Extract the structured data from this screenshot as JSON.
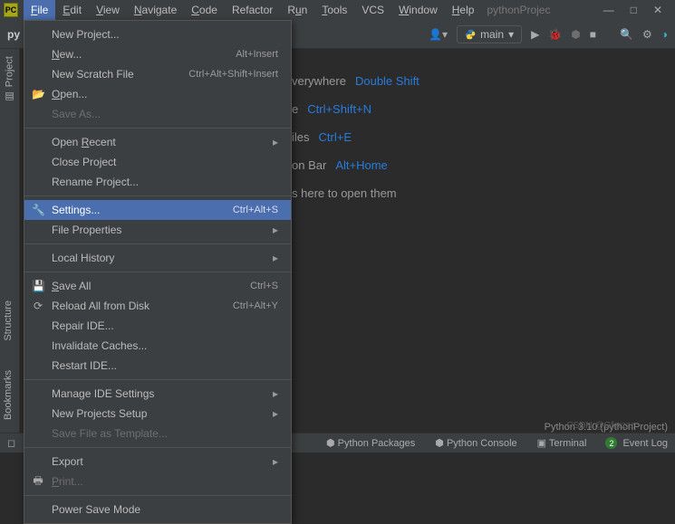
{
  "title": {
    "project": "pythonProjec"
  },
  "menus": [
    "File",
    "Edit",
    "View",
    "Navigate",
    "Code",
    "Refactor",
    "Run",
    "Tools",
    "VCS",
    "Window",
    "Help"
  ],
  "menu_underlines": [
    "F",
    "E",
    "V",
    "N",
    "C",
    "",
    "u",
    "T",
    "",
    "W",
    "H"
  ],
  "toolbar": {
    "tab": "py",
    "run_config": "main"
  },
  "file_menu": {
    "new_project": "New Project...",
    "new": "New...",
    "new_sc": "Alt+Insert",
    "scratch": "New Scratch File",
    "scratch_sc": "Ctrl+Alt+Shift+Insert",
    "open": "Open...",
    "save_as": "Save As...",
    "open_recent": "Open Recent",
    "close_project": "Close Project",
    "rename_project": "Rename Project...",
    "settings": "Settings...",
    "settings_sc": "Ctrl+Alt+S",
    "file_properties": "File Properties",
    "local_history": "Local History",
    "save_all": "Save All",
    "save_all_sc": "Ctrl+S",
    "reload": "Reload All from Disk",
    "reload_sc": "Ctrl+Alt+Y",
    "repair": "Repair IDE...",
    "invalidate": "Invalidate Caches...",
    "restart": "Restart IDE...",
    "manage_ide": "Manage IDE Settings",
    "new_proj_setup": "New Projects Setup",
    "save_template": "Save File as Template...",
    "export": "Export",
    "print": "Print...",
    "power_save": "Power Save Mode"
  },
  "editor_hints": {
    "search_lbl": "verywhere",
    "search_key": "Double Shift",
    "file_lbl": "e",
    "file_key": "Ctrl+Shift+N",
    "recent_lbl": "iles",
    "recent_key": "Ctrl+E",
    "nav_lbl": "on Bar",
    "nav_key": "Alt+Home",
    "drop": "s here to open them"
  },
  "rails": {
    "project": "Project",
    "structure": "Structure",
    "bookmarks": "Bookmarks"
  },
  "statusbar": {
    "py_packages": "Python Packages",
    "py_console": "Python Console",
    "terminal": "Terminal",
    "event_log": "Event Log",
    "event_count": "2",
    "interpreter": "Python 3.10 (pythonProject)"
  },
  "watermark": "CSDN @Gfarzzz"
}
